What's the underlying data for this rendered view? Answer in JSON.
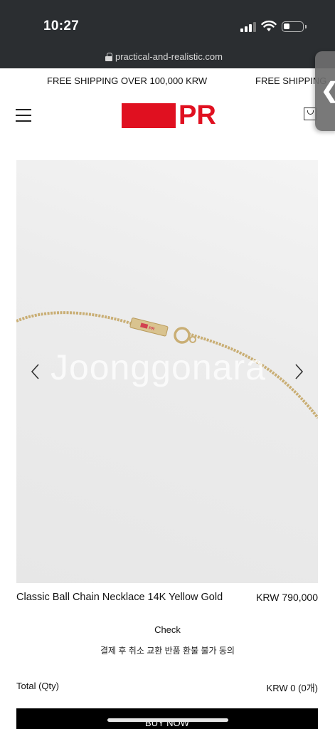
{
  "status_bar": {
    "time": "10:27"
  },
  "browser": {
    "url": "practical-and-realistic.com"
  },
  "announcement": {
    "left_text": "FREE SHIPPING OVER 100,000 KRW",
    "right_text": "FREE SHIPPING"
  },
  "header": {
    "logo_text": "PR"
  },
  "product": {
    "watermark": "Joonggonara",
    "name": "Classic Ball Chain Necklace 14K Yellow Gold",
    "price": "KRW 790,000"
  },
  "agreement": {
    "check_label": "Check",
    "text": "결제 후 취소 교환 반품 환불 불가 동의"
  },
  "total": {
    "label": "Total (Qty)",
    "value": "KRW 0 (0개)"
  },
  "buy_button": {
    "label": "BUY NOW"
  },
  "colors": {
    "brand_red": "#e01020",
    "status_bar_bg": "#2b2e31",
    "button_bg": "#000000"
  },
  "icons": [
    "lock-icon",
    "hamburger-menu-icon",
    "cart-icon",
    "chevron-left-icon",
    "chevron-right-icon",
    "back-chevron-icon"
  ]
}
